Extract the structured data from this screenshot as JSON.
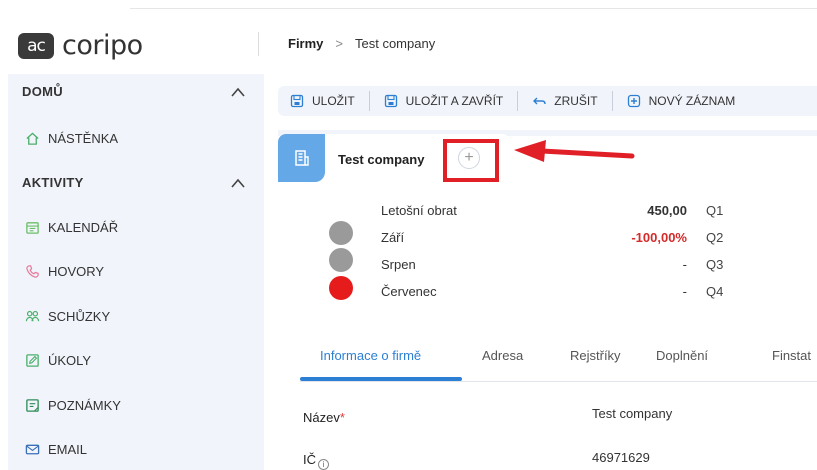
{
  "app": {
    "logo_mark": "ac",
    "logo_text": "coripo"
  },
  "breadcrumb": {
    "root": "Firmy",
    "separator": ">",
    "current": "Test company"
  },
  "sidebar": {
    "groups": [
      {
        "label": "DOMŮ",
        "items": [
          {
            "label": "NÁSTĚNKA",
            "icon": "home-icon"
          }
        ]
      },
      {
        "label": "AKTIVITY",
        "items": [
          {
            "label": "KALENDÁŘ",
            "icon": "calendar-icon"
          },
          {
            "label": "HOVORY",
            "icon": "phone-icon"
          },
          {
            "label": "SCHŮZKY",
            "icon": "people-icon"
          },
          {
            "label": "ÚKOLY",
            "icon": "edit-task-icon"
          },
          {
            "label": "POZNÁMKY",
            "icon": "note-icon"
          },
          {
            "label": "EMAIL",
            "icon": "mail-icon"
          }
        ]
      }
    ]
  },
  "toolbar": {
    "save_label": "ULOŽIT",
    "save_close_label": "ULOŽIT A ZAVŘÍT",
    "cancel_label": "ZRUŠIT",
    "new_record_label": "NOVÝ ZÁZNAM"
  },
  "record": {
    "title": "Test company",
    "add_symbol": "+"
  },
  "stats": [
    {
      "label": "Letošní obrat",
      "value": "450,00",
      "quarter": "Q1",
      "dot": null
    },
    {
      "label": "Září",
      "value": "-100,00%",
      "quarter": "Q2",
      "dot": "#9a9a9a"
    },
    {
      "label": "Srpen",
      "value": "-",
      "quarter": "Q3",
      "dot": "#9a9a9a"
    },
    {
      "label": "Červenec",
      "value": "-",
      "quarter": "Q4",
      "dot": "#e61c1c"
    }
  ],
  "tabs": [
    {
      "label": "Informace o firmě",
      "active": true
    },
    {
      "label": "Adresa",
      "active": false
    },
    {
      "label": "Rejstříky",
      "active": false
    },
    {
      "label": "Doplnění",
      "active": false
    },
    {
      "label": "Finstat",
      "active": false
    }
  ],
  "form": {
    "name_label": "Název",
    "name_required": "*",
    "name_value": "Test company",
    "ic_label": "IČ",
    "ic_info": "i",
    "ic_value": "46971629"
  },
  "colors": {
    "accent": "#2d7fd3",
    "sidebar_bg": "#f1f5fb",
    "highlight": "#e01f26",
    "negative": "#d42a2a",
    "entity_icon": "#64a8e8"
  }
}
